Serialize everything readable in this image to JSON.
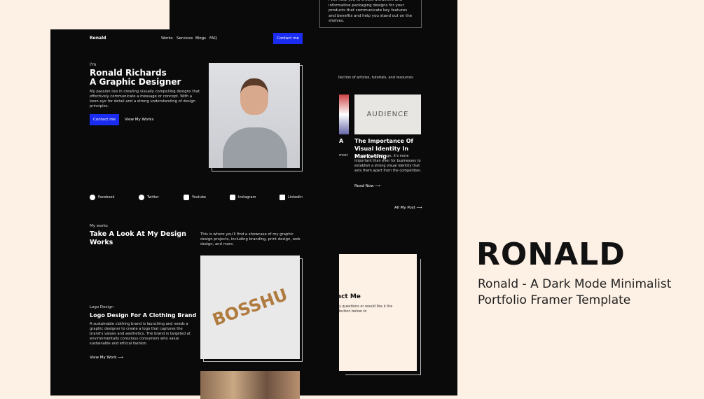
{
  "brand": {
    "title": "RONALD",
    "subtitle": "Ronald - A Dark Mode Minimalist Portfolio Framer Template"
  },
  "nav": {
    "logo": "Ronald",
    "items": [
      "Works",
      "Services",
      "Blogs",
      "FAQ"
    ],
    "contact": "Contact me"
  },
  "hero": {
    "intro": "I'm",
    "name": "Ronald Richards",
    "role": "A Graphic Designer",
    "desc": "My passion lies in creating visually compelling designs that effectively communicate a message or concept. With a keen eye for detail and a strong understanding of design principles.",
    "cta": "Contact me",
    "works_link": "View My Works"
  },
  "social": [
    "Facebook",
    "Twitter",
    "Youtube",
    "Instagram",
    "Linkedin"
  ],
  "works": {
    "eyebrow": "My works",
    "title": "Take A Look At My Design Works",
    "desc": "This is where you'll find a showcase of my graphic design projects, including branding, print design, web design, and more.",
    "project": {
      "category": "Logo Design",
      "title": "Logo Design For A Clothing Brand",
      "desc": "A sustainable clothing brand is launching and needs a graphic designer to create a logo that captures the brand's values and aesthetics. The brand is targeted at environmentally conscious consumers who value sustainable and ethical fashion.",
      "link": "View My Work ⟶",
      "image_text": "BOSSHU"
    }
  },
  "service_card": {
    "desc": "I will help you to create attractive and informative packaging designs for your products that communicate key features and benefits and help you stand out on the shelves."
  },
  "blog": {
    "intro": "llection of articles, tutorials, and resources",
    "post_partial": "A",
    "post_partial_desc": "most",
    "post": {
      "image_text": "AUDIENCE",
      "title": "The Importance Of Visual Identity In Marketing",
      "desc": "In today's digital age, it's more important than ever for businesses to establish a strong visual identity that sets them apart from the competition.",
      "link": "Read Now ⟶"
    },
    "all": "All My Post ⟶"
  },
  "contact": {
    "title": "act Me",
    "desc": "y questions or would like k the button below to"
  }
}
